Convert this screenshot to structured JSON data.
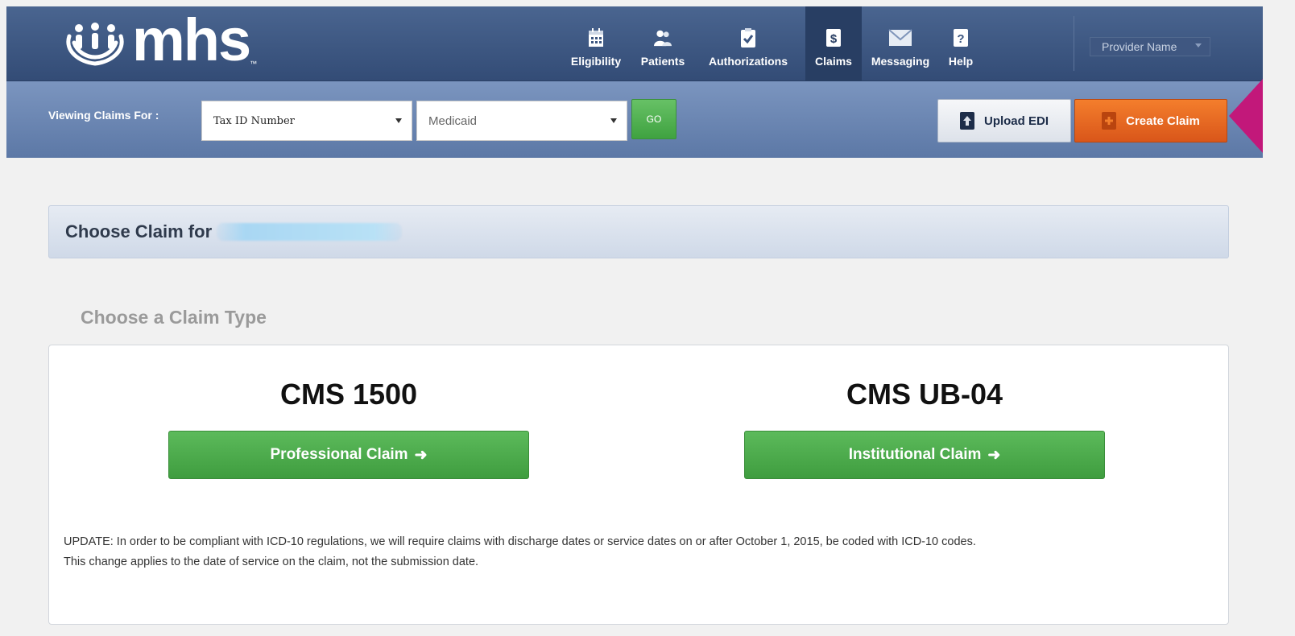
{
  "brand": {
    "logo_text": "mhs",
    "trademark": "™"
  },
  "nav": {
    "items": [
      {
        "label": "Eligibility",
        "icon": "calendar-icon",
        "active": false
      },
      {
        "label": "Patients",
        "icon": "people-icon",
        "active": false
      },
      {
        "label": "Authorizations",
        "icon": "clipboard-check-icon",
        "active": false
      },
      {
        "label": "Claims",
        "icon": "dollar-document-icon",
        "active": true
      },
      {
        "label": "Messaging",
        "icon": "envelope-icon",
        "active": false
      },
      {
        "label": "Help",
        "icon": "question-document-icon",
        "active": false
      }
    ],
    "provider_label": "Provider Name"
  },
  "subbar": {
    "viewing_label": "Viewing Claims For :",
    "tax_id_value": "Tax ID Number",
    "plan_value": "Medicaid",
    "go_label": "GO",
    "upload_label": "Upload EDI",
    "create_label": "Create Claim"
  },
  "content": {
    "header_label": "Choose Claim for",
    "section_title": "Choose a Claim Type",
    "options": [
      {
        "form": "CMS 1500",
        "button": "Professional Claim"
      },
      {
        "form": "CMS UB-04",
        "button": "Institutional Claim"
      }
    ],
    "arrow_glyph": "➜",
    "note_line1": "UPDATE: In order to be compliant with ICD-10 regulations, we will require claims with discharge dates or service dates on or after October 1, 2015, be coded with ICD-10 codes.",
    "note_line2": "This change applies to the date of service on the claim, not the submission date."
  },
  "colors": {
    "nav_bg": "#3b5580",
    "subbar_bg": "#6a86b3",
    "accent_green": "#4cae4c",
    "accent_orange": "#e8661f",
    "pointer": "#c2187a"
  }
}
